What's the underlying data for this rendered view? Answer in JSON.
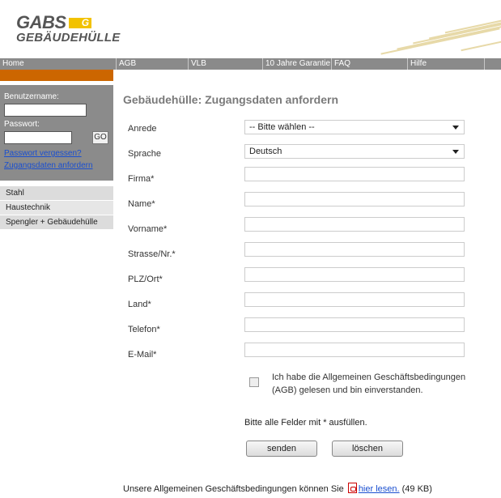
{
  "logo": {
    "line1": "GABS",
    "badge": "G",
    "line2": "GEBÄUDEHÜLLE"
  },
  "nav": [
    "Home",
    "AGB",
    "VLB",
    "10 Jahre Garantie",
    "FAQ",
    "Hilfe"
  ],
  "login": {
    "username_label": "Benutzername:",
    "username_value": "",
    "password_label": "Passwort:",
    "password_value": "",
    "go_label": "GO",
    "forgot_link": "Passwort vergessen?",
    "request_link": "Zugangsdaten anfordern"
  },
  "categories": [
    "Stahl",
    "Haustechnik",
    "Spengler + Gebäudehülle"
  ],
  "form": {
    "title": "Gebäudehülle: Zugangsdaten anfordern",
    "anrede_label": "Anrede",
    "anrede_value": "-- Bitte wählen --",
    "sprache_label": "Sprache",
    "sprache_value": "Deutsch",
    "firma_label": "Firma*",
    "name_label": "Name*",
    "vorname_label": "Vorname*",
    "strasse_label": "Strasse/Nr.*",
    "plz_label": "PLZ/Ort*",
    "land_label": "Land*",
    "telefon_label": "Telefon*",
    "email_label": "E-Mail*",
    "agb_text": "Ich habe die Allgemeinen Geschäftsbedingungen (AGB) gelesen und bin einverstanden.",
    "hint": "Bitte alle Felder mit * ausfüllen.",
    "send_label": "senden",
    "clear_label": "löschen"
  },
  "footer": {
    "text": "Unsere Allgemeinen Geschäftsbedingungen können Sie",
    "pdf_icon": "pdf-icon",
    "link": "hier lesen.",
    "size": "(49 KB)"
  },
  "colors": {
    "nav": "#8a8a8a",
    "accent": "#cc6600",
    "link": "#1a4fd0",
    "logo_yellow": "#f2c200"
  }
}
